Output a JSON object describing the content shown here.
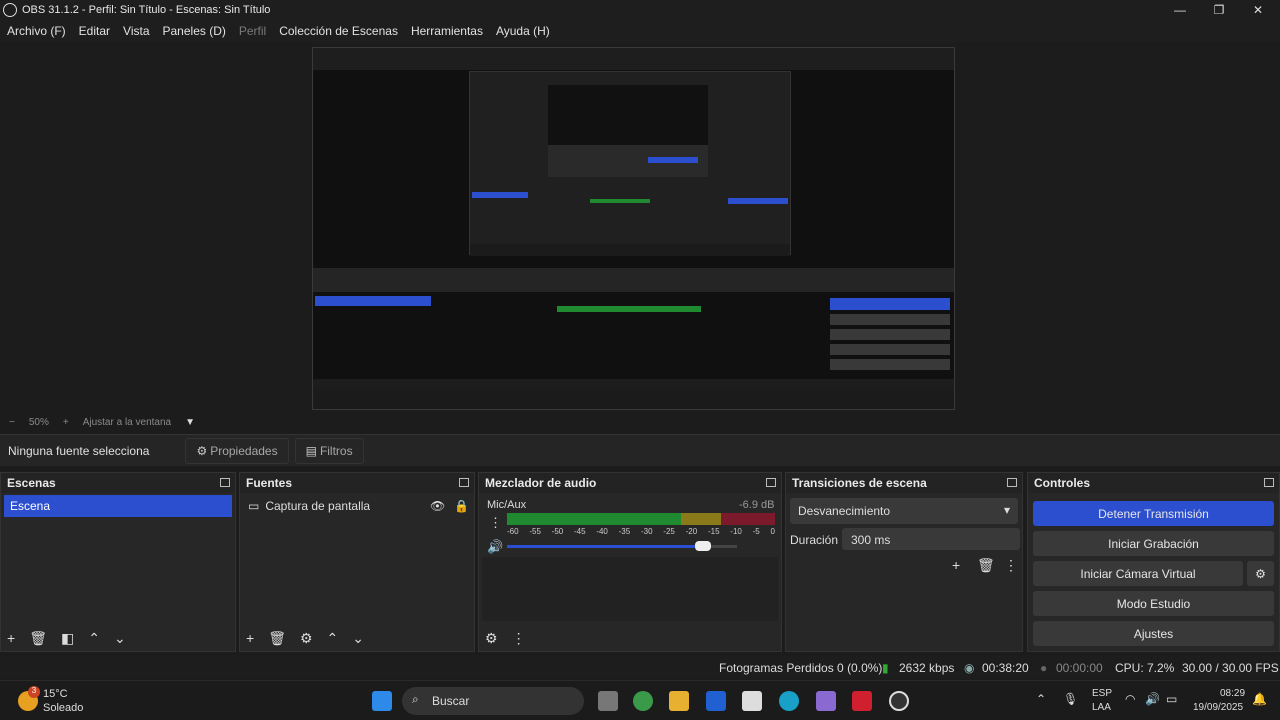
{
  "window": {
    "title": "OBS 31.1.2 - Perfil: Sin Título - Escenas: Sin Título",
    "minimize": "—",
    "maximize": "❐",
    "close": "✕"
  },
  "menu": {
    "items": [
      {
        "label": "Archivo (F)",
        "enabled": true
      },
      {
        "label": "Editar",
        "enabled": true
      },
      {
        "label": "Vista",
        "enabled": true
      },
      {
        "label": "Paneles (D)",
        "enabled": true
      },
      {
        "label": "Perfil",
        "enabled": false
      },
      {
        "label": "Colección de Escenas",
        "enabled": true
      },
      {
        "label": "Herramientas",
        "enabled": true
      },
      {
        "label": "Ayuda (H)",
        "enabled": true
      }
    ]
  },
  "zoom": {
    "minus": "−",
    "level": "50%",
    "plus": "+",
    "fit": "Ajustar a la ventana"
  },
  "source_bar": {
    "no_source": "Ninguna fuente selecciona",
    "properties": "Propiedades",
    "filters": "Filtros"
  },
  "scenes": {
    "title": "Escenas",
    "items": [
      "Escena"
    ]
  },
  "sources": {
    "title": "Fuentes",
    "items": [
      {
        "name": "Captura de pantalla",
        "icon": "monitor-icon"
      }
    ]
  },
  "mixer": {
    "title": "Mezclador de audio",
    "channel": "Mic/Aux",
    "db": "-6.9 dB",
    "ticks": [
      "-60",
      "-55",
      "-50",
      "-45",
      "-40",
      "-35",
      "-30",
      "-25",
      "-20",
      "-15",
      "-10",
      "-5",
      "0"
    ],
    "volume_level": 0.85
  },
  "transitions": {
    "title": "Transiciones de escena",
    "selected": "Desvanecimiento",
    "duration_label": "Duración",
    "duration_value": "300 ms"
  },
  "controls": {
    "title": "Controles",
    "buttons": [
      "Detener Transmisión",
      "Iniciar Grabación",
      "Iniciar Cámara Virtual",
      "Modo Estudio",
      "Ajustes"
    ]
  },
  "status": {
    "dropped": "Fotogramas Perdidos 0 (0.0%)",
    "bitrate": "2632 kbps",
    "stream_time": "00:38:20",
    "rec_time": "00:00:00",
    "cpu": "CPU: 7.2%",
    "fps": "30.00 / 30.00 FPS"
  },
  "taskbar": {
    "weather_badge": "3",
    "temp": "15°C",
    "condition": "Soleado",
    "search": "Buscar",
    "lang1": "ESP",
    "lang2": "LAA",
    "time": "08:29",
    "date": "19/09/2025"
  },
  "colors": {
    "accent": "#2b4fce",
    "meter_green": "#1f8a2f",
    "meter_yellow": "#8a7a1a",
    "meter_red": "#7a1a2a"
  }
}
